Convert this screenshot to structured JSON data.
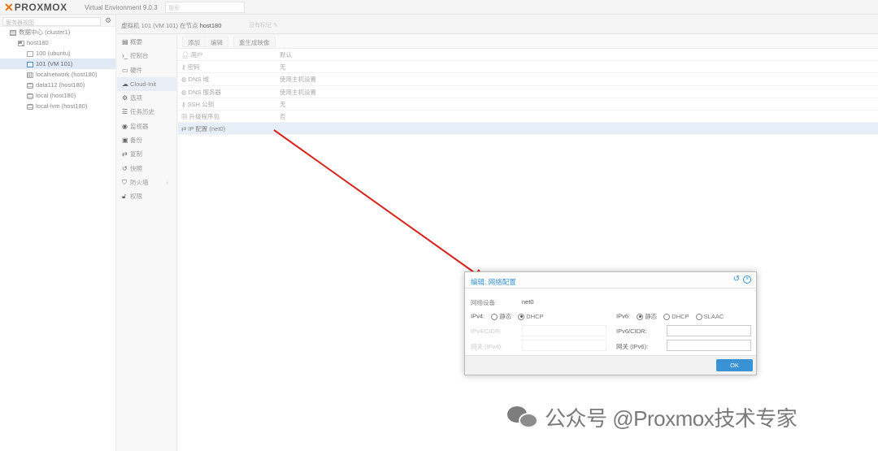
{
  "header": {
    "logo_text": "PROXMOX",
    "product": "Virtual Environment 9.0.3",
    "search_placeholder": "搜索"
  },
  "tree": {
    "view_select": "服务器视图",
    "items": [
      {
        "label": "数据中心 (cluster1)",
        "icon": "datacenter-icon"
      },
      {
        "label": "host180",
        "icon": "server-icon"
      },
      {
        "label": "100 (ubuntu)",
        "icon": "vm-icon"
      },
      {
        "label": "101 (VM 101)",
        "icon": "vm-icon"
      },
      {
        "label": "localnetwork (host180)",
        "icon": "network-icon"
      },
      {
        "label": "data112 (host180)",
        "icon": "storage-icon"
      },
      {
        "label": "local (host180)",
        "icon": "storage-icon"
      },
      {
        "label": "local-lvm (host180)",
        "icon": "storage-icon"
      }
    ]
  },
  "content": {
    "title": "虚拟机 101 (VM 101) 在节点 ",
    "node": "host180",
    "tag_hint": "没有标记"
  },
  "subnav": [
    {
      "label": "概要",
      "icon": "book-icon"
    },
    {
      "label": "控制台",
      "icon": "terminal-icon"
    },
    {
      "label": "硬件",
      "icon": "monitor-icon"
    },
    {
      "label": "Cloud-Init",
      "icon": "cloud-icon"
    },
    {
      "label": "选项",
      "icon": "gear-icon"
    },
    {
      "label": "任务历史",
      "icon": "list-icon"
    },
    {
      "label": "监视器",
      "icon": "eye-icon"
    },
    {
      "label": "备份",
      "icon": "floppy-icon"
    },
    {
      "label": "复制",
      "icon": "retweet-icon"
    },
    {
      "label": "快照",
      "icon": "history-icon"
    },
    {
      "label": "防火墙",
      "icon": "shield-icon"
    },
    {
      "label": "权限",
      "icon": "unlock-icon"
    }
  ],
  "toolbar": {
    "add": "添加",
    "edit": "编辑",
    "regenerate": "重生成映像"
  },
  "properties": [
    {
      "key": "用户",
      "value": "默认",
      "icon": "user-icon"
    },
    {
      "key": "密码",
      "value": "无",
      "icon": "key-icon"
    },
    {
      "key": "DNS 域",
      "value": "使用主机设置",
      "icon": "globe-icon"
    },
    {
      "key": "DNS 服务器",
      "value": "使用主机设置",
      "icon": "globe-icon"
    },
    {
      "key": "SSH 公钥",
      "value": "无",
      "icon": "key-icon"
    },
    {
      "key": "升级程序包",
      "value": "否",
      "icon": "package-icon"
    },
    {
      "key": "IP 配置 (net0)",
      "value": "",
      "icon": "exchange-icon"
    }
  ],
  "dialog": {
    "title_prefix": "编辑:",
    "title": "网络配置",
    "device_label": "网络设备:",
    "device_value": "net0",
    "ipv4_label": "IPv4:",
    "ipv4_static": "静态",
    "ipv4_dhcp": "DHCP",
    "ipv4_selected": "DHCP",
    "ipv4_cidr_label": "IPv4/CIDR:",
    "gateway4_label": "网关 (IPv4):",
    "ipv6_label": "IPv6:",
    "ipv6_static": "静态",
    "ipv6_dhcp": "DHCP",
    "ipv6_slaac": "SLAAC",
    "ipv6_selected": "静态",
    "ipv6_cidr_label": "IPv6/CIDR:",
    "gateway6_label": "网关 (IPv6):",
    "ok": "OK"
  },
  "watermark": "公众号 @Proxmox技术专家",
  "colors": {
    "accent": "#3892d4",
    "logo_orange": "#e57000",
    "arrow_red": "#d9231d",
    "selected_row": "#e6eef7"
  }
}
